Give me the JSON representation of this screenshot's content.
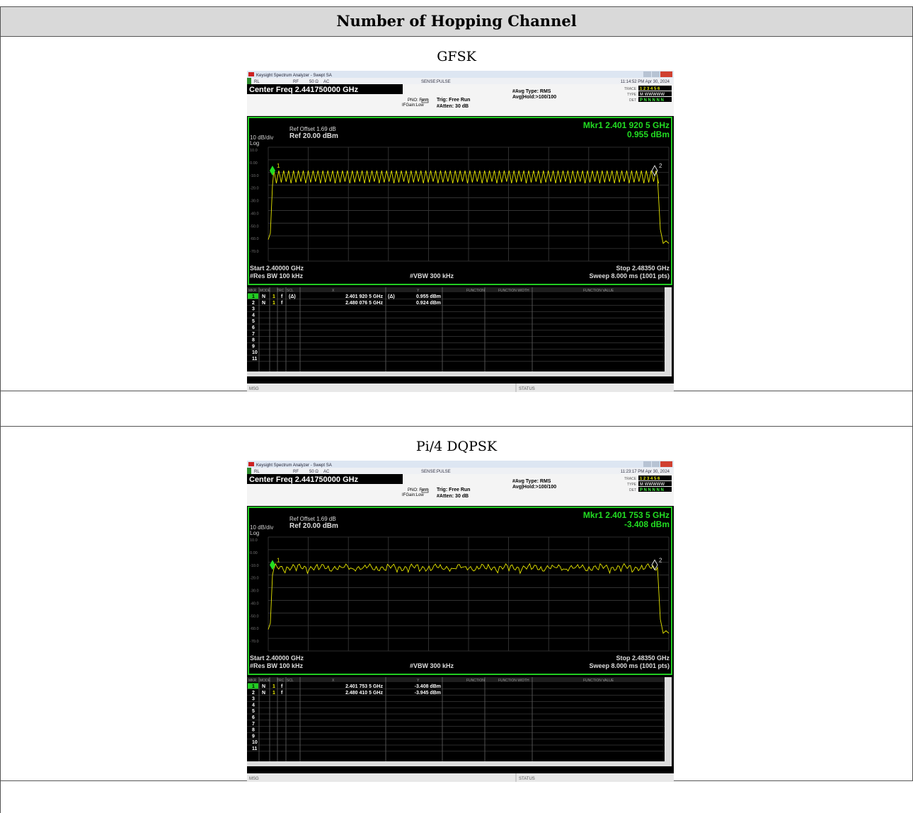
{
  "document": {
    "header": "Number of Hopping Channel",
    "sections": [
      {
        "caption": "GFSK",
        "analyzer": {
          "title_bar": "Keysight Spectrum Analyzer - Swept SA",
          "status_rl": "RL",
          "status_rf": "RF",
          "status_ohm": "50 Ω",
          "status_ac": "AC",
          "sense": "SENSE:PULSE",
          "datetime": "11:14:52 PM Apr 30, 2024",
          "center_freq": "Center Freq 2.441750000 GHz",
          "pno": "PNO: Fast",
          "ifgain": "IFGain:Low",
          "trig": "Trig: Free Run",
          "atten": "#Atten: 30 dB",
          "avg_type": "#Avg Type: RMS",
          "avg_hold": "Avg|Hold:>100/100",
          "trace_lbl": "TRACE",
          "type_lbl": "TYPE",
          "det_lbl": "DET",
          "trace_nums": "1 2 3 4 5 6",
          "type_val": "M WWWWW",
          "det_val": "P N N N N N",
          "ref_offset": "Ref Offset 1.69 dB",
          "scale": "10 dB/div",
          "ref_level": "Ref 20.00 dBm",
          "log": "Log",
          "mkr_freq": "Mkr1 2.401 920 5 GHz",
          "mkr_level": "0.955 dBm",
          "yticks": [
            "10.0",
            "0.00",
            "-10.0",
            "-20.0",
            "-30.0",
            "-40.0",
            "-50.0",
            "-60.0",
            "-70.0"
          ],
          "start": "Start 2.40000 GHz",
          "rbw": "#Res BW 100 kHz",
          "vbw": "#VBW 300 kHz",
          "stop": "Stop 2.48350 GHz",
          "sweep": "Sweep  8.000 ms (1001 pts)",
          "table_headers": [
            "MKR",
            "MODE",
            "TRC",
            "SCL",
            "X",
            "Y",
            "FUNCTION",
            "FUNCTION WIDTH",
            "FUNCTION VALUE"
          ],
          "rows": [
            {
              "n": "1",
              "mode": "N",
              "trc": "1",
              "scl": "f",
              "delta": "(Δ)",
              "x": "2.401 920 5 GHz",
              "xd": "(Δ)",
              "y": "0.955 dBm"
            },
            {
              "n": "2",
              "mode": "N",
              "trc": "1",
              "scl": "f",
              "delta": "",
              "x": "2.480 076 5 GHz",
              "xd": "",
              "y": "0.924 dBm"
            }
          ],
          "empty_rows": [
            "3",
            "4",
            "5",
            "6",
            "7",
            "8",
            "9",
            "10",
            "11"
          ],
          "msg": "MSG",
          "status": "STATUS",
          "trace_style": "hop",
          "marker1_label": "1",
          "marker2_label": "2"
        }
      },
      {
        "caption": "Pi/4 DQPSK",
        "analyzer": {
          "title_bar": "Keysight Spectrum Analyzer - Swept SA",
          "status_rl": "RL",
          "status_rf": "RF",
          "status_ohm": "50 Ω",
          "status_ac": "AC",
          "sense": "SENSE:PULSE",
          "datetime": "11:23:17 PM Apr 30, 2024",
          "center_freq": "Center Freq 2.441750000 GHz",
          "pno": "PNO: Fast",
          "ifgain": "IFGain:Low",
          "trig": "Trig: Free Run",
          "atten": "#Atten: 30 dB",
          "avg_type": "#Avg Type: RMS",
          "avg_hold": "Avg|Hold:>100/100",
          "trace_lbl": "TRACE",
          "type_lbl": "TYPE",
          "det_lbl": "DET",
          "trace_nums": "1 2 3 4 5 6",
          "type_val": "M WWWWW",
          "det_val": "P N N N N N",
          "ref_offset": "Ref Offset 1.69 dB",
          "scale": "10 dB/div",
          "ref_level": "Ref 20.00 dBm",
          "log": "Log",
          "mkr_freq": "Mkr1 2.401 753 5 GHz",
          "mkr_level": "-3.408 dBm",
          "yticks": [
            "10.0",
            "0.00",
            "-10.0",
            "-20.0",
            "-30.0",
            "-40.0",
            "-50.0",
            "-60.0",
            "-70.0"
          ],
          "start": "Start 2.40000 GHz",
          "rbw": "#Res BW 100 kHz",
          "vbw": "#VBW 300 kHz",
          "stop": "Stop 2.48350 GHz",
          "sweep": "Sweep  8.000 ms (1001 pts)",
          "table_headers": [
            "MKR",
            "MODE",
            "TRC",
            "SCL",
            "X",
            "Y",
            "FUNCTION",
            "FUNCTION WIDTH",
            "FUNCTION VALUE"
          ],
          "rows": [
            {
              "n": "1",
              "mode": "N",
              "trc": "1",
              "scl": "f",
              "delta": "",
              "x": "2.401 753 5 GHz",
              "xd": "",
              "y": "-3.408 dBm"
            },
            {
              "n": "2",
              "mode": "N",
              "trc": "1",
              "scl": "f",
              "delta": "",
              "x": "2.480 410 5 GHz",
              "xd": "",
              "y": "-3.945 dBm"
            }
          ],
          "empty_rows": [
            "3",
            "4",
            "5",
            "6",
            "7",
            "8",
            "9",
            "10",
            "11"
          ],
          "msg": "MSG",
          "status": "STATUS",
          "trace_style": "flat",
          "marker1_label": "1",
          "marker2_label": "2"
        }
      }
    ]
  }
}
